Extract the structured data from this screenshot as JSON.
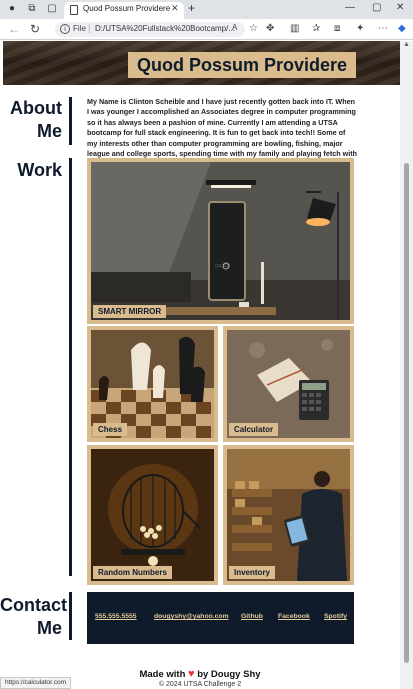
{
  "browser": {
    "tab_title": "Quod Possum Providere",
    "address": {
      "scheme_label": "File",
      "url": "D:/UTSA%20Fullstack%20Bootcamp/..."
    },
    "status_url": "https://calculator.com"
  },
  "page": {
    "hero_title": "Quod Possum Providere",
    "about": {
      "heading_line1": "About",
      "heading_line2": "Me",
      "text": "My Name is Clinton Scheible and I have just recently gotten back into IT. When I was younger I accomplished an Associates degree in computer programming so it has always been a pashion of mine. Currently I am attending a UTSA bootcamp for full stack engineering. It is fun to get back into tech!! Some of my interests other than computer programming are bowling, fishing, major league and college sports, spending time with my family and playing fetch with my dog."
    },
    "work": {
      "heading": "Work",
      "projects": [
        {
          "label": "SMART MIRROR"
        },
        {
          "label": "Chess"
        },
        {
          "label": "Calculator"
        },
        {
          "label": "Random Numbers"
        },
        {
          "label": "Inventory"
        }
      ]
    },
    "contact": {
      "heading_line1": "Contact",
      "heading_line2": "Me",
      "links": [
        {
          "label": "555.555.5555"
        },
        {
          "label": "dougyshy@yahoo.com"
        },
        {
          "label": "Github"
        },
        {
          "label": "Facebook"
        },
        {
          "label": "Spotify"
        }
      ]
    },
    "footer": {
      "made_prefix": "Made with",
      "made_suffix": "by Dougy Shy",
      "copyright": "© 2024 UTSA Challenge 2"
    }
  },
  "colors": {
    "navy": "#0f1b2b",
    "tan": "#d9bb8d",
    "heart": "#e53935"
  }
}
